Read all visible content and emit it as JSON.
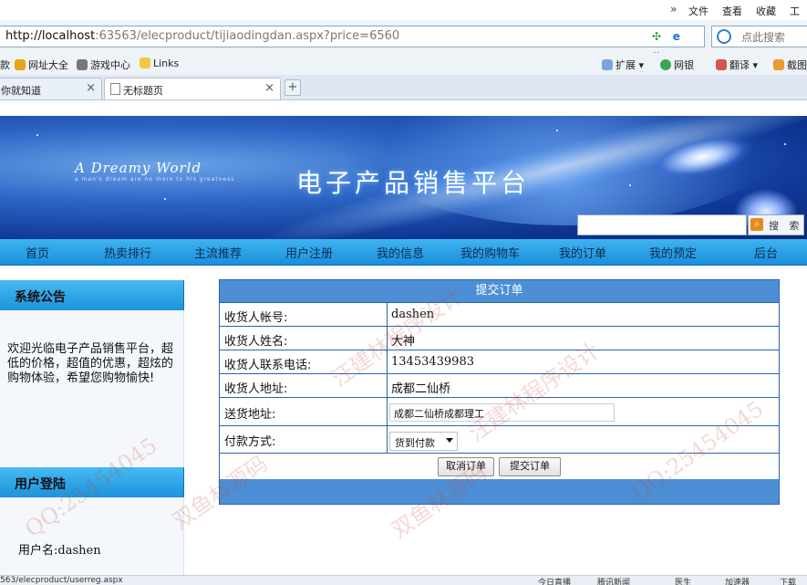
{
  "browser": {
    "menu": [
      "文件",
      "查看",
      "收藏",
      "工具"
    ],
    "menu_more": "»",
    "url_host": "http://localhost",
    "url_rest": ":63563/elecproduct/tijiaodingdan.aspx?price=6560",
    "search_placeholder": "点此搜索",
    "favorites": [
      "款",
      "网址大全",
      "游戏中心",
      "Links"
    ],
    "toolbar_right": [
      "扩展",
      "网银",
      "翻译",
      "截图"
    ],
    "tabs": [
      {
        "label": "你就知道"
      },
      {
        "label": "无标题页"
      }
    ],
    "new_tab": "+",
    "status_left": "563/elecproduct/userreg.aspx",
    "status_right": [
      "今日直播",
      "腾讯新闻",
      "医生",
      "加速器",
      "下载"
    ]
  },
  "site": {
    "logo": "A Dreamy World",
    "logo_sub": "a man's dream are no more to his greatness",
    "title": "电子产品销售平台",
    "search_button": "搜 索"
  },
  "nav": [
    "首页",
    "热卖排行",
    "主流推荐",
    "用户注册",
    "我的信息",
    "我的购物车",
    "我的订单",
    "我的预定",
    "后台"
  ],
  "sidebar": {
    "notice_title": "系统公告",
    "notice_text": "欢迎光临电子产品销售平台，超低的价格，超值的优惠，超炫的购物体验，希望您购物愉快!",
    "login_title": "用户登陆",
    "login_user": "用户名:dashen"
  },
  "order": {
    "title": "提交订单",
    "fields": [
      {
        "label": "收货人帐号:",
        "value": "dashen"
      },
      {
        "label": "收货人姓名:",
        "value": "大神"
      },
      {
        "label": "收货人联系电话:",
        "value": "13453439983"
      },
      {
        "label": "收货人地址:",
        "value": "成都二仙桥"
      },
      {
        "label": "送货地址:",
        "value": "成都二仙桥成都理工"
      },
      {
        "label": "付款方式:",
        "value": "货到付款"
      }
    ],
    "cancel_button": "取消订单",
    "submit_button": "提交订单"
  },
  "watermarks": [
    "QQ:25454045",
    "双鱼林源码",
    "汪建林程序设计",
    "QQ:25454045",
    "汪建林程序设计",
    "双鱼林源码"
  ],
  "colors": {
    "nav_top": "#3fb4f0",
    "nav_bottom": "#1a8fda",
    "table_header": "#4d8fd6",
    "table_border": "#2a66a8"
  }
}
